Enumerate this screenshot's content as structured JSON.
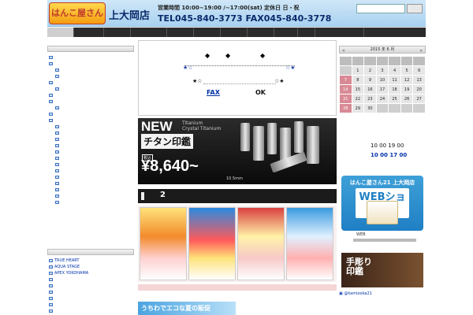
{
  "header": {
    "logo_text": "はんこ屋さん21",
    "store_name": "上大岡店",
    "hours_line": "営業時間  10:00~19:00  /~17:00(sat)    定休日  日・祝",
    "tel_fax": "TEL045-840-3773  FAX045-840-3778",
    "search_placeholder": "",
    "search_button": ""
  },
  "nav": {
    "items": [
      "",
      "",
      "",
      "",
      "",
      "",
      "",
      "",
      "",
      "",
      "",
      ""
    ]
  },
  "notice": {
    "fax_link": "FAX",
    "ok_text": "OK",
    "diamonds": [
      "◆",
      "◆",
      "◆"
    ],
    "stars_top": [
      "★☆",
      "☆★"
    ],
    "stars_bottom": [
      "★☆",
      "☆★"
    ]
  },
  "banner": {
    "new_label": "NEW",
    "small_en": "Titanium\nCrystal Titanium",
    "jp_title": "チタン印鑑",
    "tax_label": "税込",
    "price": "¥8,640~",
    "size_note": "10.5mm"
  },
  "section": {
    "number": "2"
  },
  "bottom_banner": {
    "text": "うちわでエコな夏の販促"
  },
  "calendar": {
    "month_label": "2015 年 6 月",
    "prev": "«",
    "next": "»",
    "weekdays": [
      "",
      "",
      "",
      "",
      "",
      "",
      ""
    ],
    "rows": [
      [
        "",
        "1",
        "2",
        "3",
        "4",
        "5",
        "6"
      ],
      [
        "7",
        "8",
        "9",
        "10",
        "11",
        "12",
        "13"
      ],
      [
        "14",
        "15",
        "16",
        "17",
        "18",
        "19",
        "20"
      ],
      [
        "21",
        "22",
        "23",
        "24",
        "25",
        "26",
        "27"
      ],
      [
        "28",
        "29",
        "30",
        "",
        "",
        "",
        ""
      ]
    ]
  },
  "right_info": {
    "weekday_hours": "10  00  19  00",
    "saturday_hours": "10  00  17  00",
    "web_shop_line1": "はんこ屋さん21 上大岡店",
    "web_shop_line2": "WEBショップ",
    "web_caption": "WEB",
    "tegaki_text": "手彫り\n印鑑",
    "insta_link": "@kamiooka21"
  },
  "left_links": {
    "items": [
      "TRUE HEART",
      "AQUA STAGE",
      "APEX YOKOHAMA",
      "",
      "",
      "",
      "",
      "",
      ""
    ]
  },
  "colors": {
    "header_bg": "#a9d2f0",
    "nav_bg": "#2b2b2b",
    "holiday": "#d98a95",
    "link": "#0033aa"
  }
}
